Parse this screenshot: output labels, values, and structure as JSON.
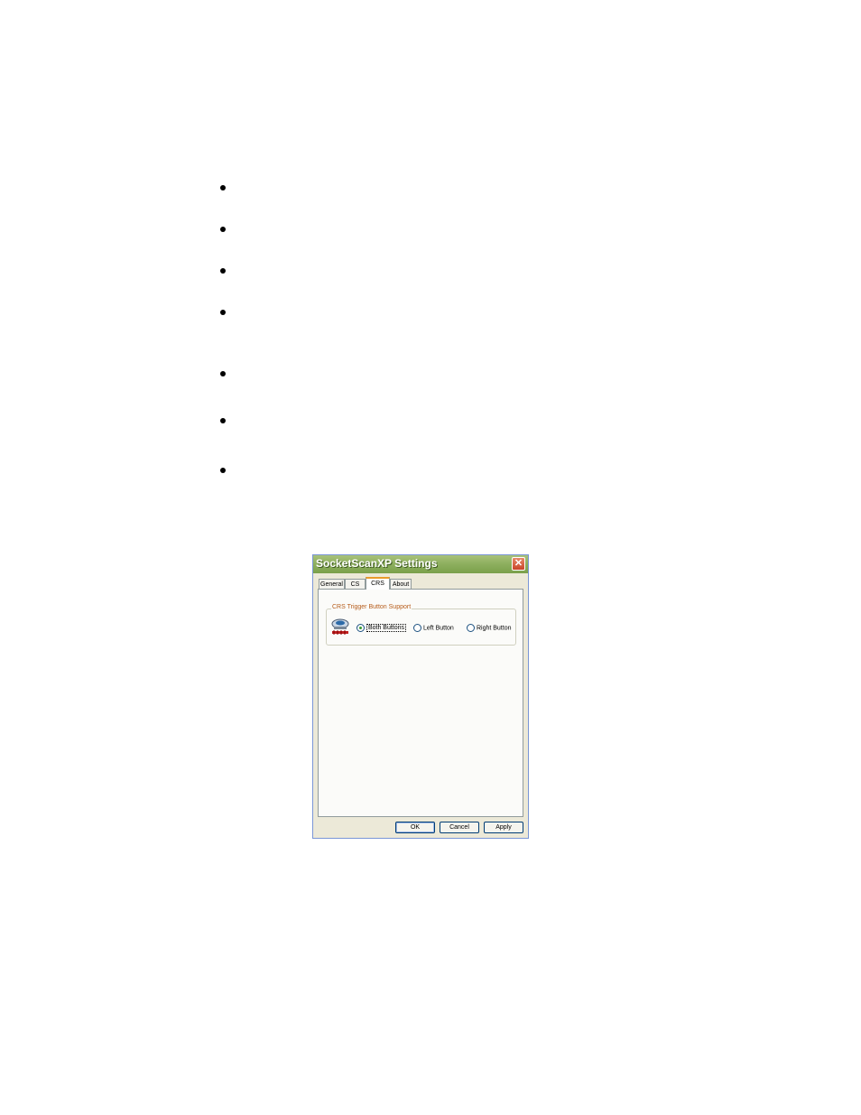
{
  "bullets_count": 7,
  "dialog": {
    "title": "SocketScanXP Settings",
    "close_glyph": "✕",
    "tabs": [
      {
        "label": "General",
        "active": false
      },
      {
        "label": "CS",
        "active": false
      },
      {
        "label": "CRS",
        "active": true
      },
      {
        "label": "About",
        "active": false
      }
    ],
    "group": {
      "legend": "CRS Trigger Button Support",
      "icon": "scanner-icon",
      "options": [
        {
          "label": "Both Buttons",
          "checked": true
        },
        {
          "label": "Left Button",
          "checked": false
        },
        {
          "label": "Right Button",
          "checked": false
        }
      ]
    },
    "buttons": {
      "ok": "OK",
      "cancel": "Cancel",
      "apply": "Apply"
    }
  },
  "colors": {
    "titlebar": "#8fb060",
    "tab_accent": "#e89b2a",
    "legend_text": "#b65c1a",
    "close": "#c8452a"
  }
}
